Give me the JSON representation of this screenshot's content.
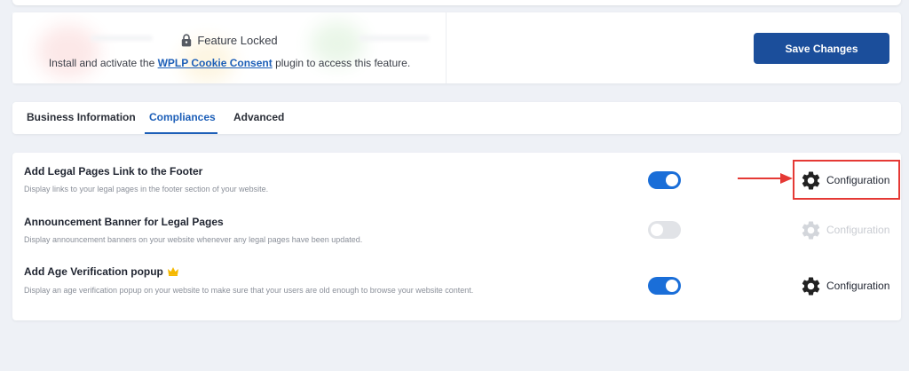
{
  "locked_card": {
    "title": "Feature Locked",
    "message_before": "Install and activate the",
    "link_text": "WPLP Cookie Consent",
    "message_after": "plugin to access this feature.",
    "save_label": "Save Changes"
  },
  "tabs": [
    {
      "label": "Business Information",
      "active": false
    },
    {
      "label": "Compliances",
      "active": true
    },
    {
      "label": "Advanced",
      "active": false
    }
  ],
  "settings": [
    {
      "title": "Add Legal Pages Link to the Footer",
      "description": "Display links to your legal pages in the footer section of your website.",
      "enabled": true,
      "config_label": "Configuration",
      "config_disabled": false,
      "highlighted": true
    },
    {
      "title": "Announcement Banner for Legal Pages",
      "description": "Display announcement banners on your website whenever any legal pages have been updated.",
      "enabled": false,
      "config_label": "Configuration",
      "config_disabled": true
    },
    {
      "title": "Add Age Verification popup",
      "description": "Display an age verification popup on your website to make sure that your users are old enough to browse your website content.",
      "enabled": true,
      "config_label": "Configuration",
      "config_disabled": false,
      "premium_icon": "crown-icon"
    }
  ],
  "colors": {
    "accent": "#1d5fb8",
    "save_button": "#1b4e9b",
    "toggle_on": "#1a6ed8",
    "toggle_off": "#e1e3e7",
    "highlight": "#e53935",
    "crown": "#f5b800"
  },
  "icons": [
    "lock-icon",
    "gear-icon",
    "crown-icon",
    "arrow-right-icon"
  ]
}
